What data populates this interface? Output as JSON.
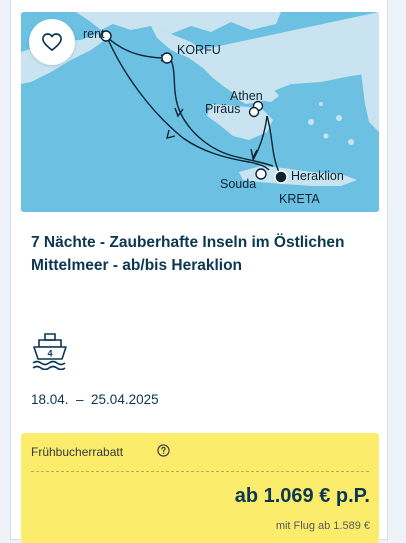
{
  "map": {
    "ports": {
      "bari_partial": "rent",
      "korfu": "KORFU",
      "athen": "Athen",
      "piraeus": "Piräus",
      "souda": "Souda",
      "heraklion": "Heraklion",
      "kreta": "KRETA"
    },
    "colors": {
      "sea": "#6cc1e3",
      "land": "#c9e4f0",
      "route": "#0b2233"
    }
  },
  "favorite": {
    "icon": "heart-icon"
  },
  "offer": {
    "title": "7 Nächte - Zauberhafte Inseln im Östlichen Mittelmeer - ab/bis Heraklion",
    "ship_icon": "cruise-ship-icon",
    "ship_badge": "4",
    "dates": "18.04.  –  25.04.2025"
  },
  "promo": {
    "label": "Frühbucherrabatt",
    "info_icon": "question-circle-icon",
    "price": "ab 1.069 € p.P.",
    "price_with_flight": "mit Flug ab 1.589 €",
    "background": "#fbec6b"
  }
}
